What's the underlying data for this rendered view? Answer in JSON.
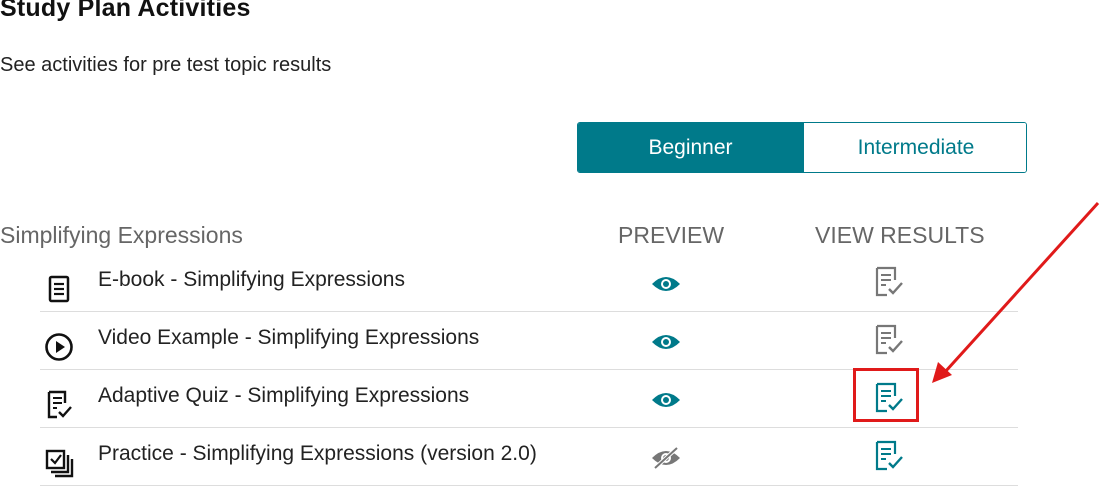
{
  "header": {
    "title": "Study Plan Activities",
    "subtitle": "See activities for pre test topic results"
  },
  "level_toggle": {
    "options": [
      {
        "label": "Beginner",
        "selected": true
      },
      {
        "label": "Intermediate",
        "selected": false
      }
    ]
  },
  "topic": {
    "name": "Simplifying Expressions",
    "columns": {
      "preview": "PREVIEW",
      "view_results": "VIEW RESULTS"
    }
  },
  "activities": [
    {
      "icon": "ebook-icon",
      "title": "E-book - Simplifying Expressions",
      "preview_enabled": true,
      "results_enabled": false
    },
    {
      "icon": "video-play-icon",
      "title": "Video Example - Simplifying Expressions",
      "preview_enabled": true,
      "results_enabled": false
    },
    {
      "icon": "quiz-icon",
      "title": "Adaptive Quiz - Simplifying Expressions",
      "preview_enabled": true,
      "results_enabled": true,
      "highlighted": true
    },
    {
      "icon": "practice-icon",
      "title": "Practice - Simplifying Expressions (version 2.0)",
      "preview_enabled": false,
      "results_enabled": true
    }
  ],
  "colors": {
    "accent": "#007a8a",
    "disabled_icon": "#777777",
    "annotation": "#e01a1a"
  }
}
